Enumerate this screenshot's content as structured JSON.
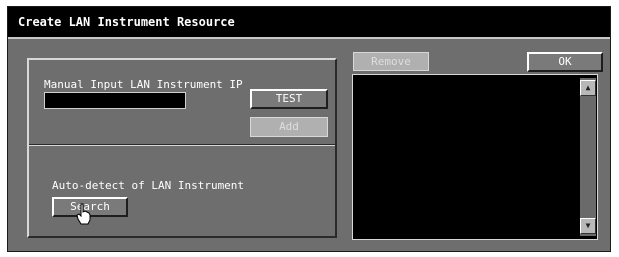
{
  "window": {
    "title": "Create LAN Instrument Resource"
  },
  "manual": {
    "label": "Manual Input LAN Instrument IP",
    "ip_value": "",
    "test_label": "TEST",
    "add_label": "Add"
  },
  "auto": {
    "label": "Auto-detect of LAN Instrument",
    "search_label": "Search"
  },
  "list": {
    "remove_label": "Remove",
    "ok_label": "OK",
    "items": []
  },
  "icons": {
    "scroll_up": "triangle-up-icon",
    "scroll_down": "triangle-down-icon",
    "cursor": "hand-pointer-icon"
  }
}
